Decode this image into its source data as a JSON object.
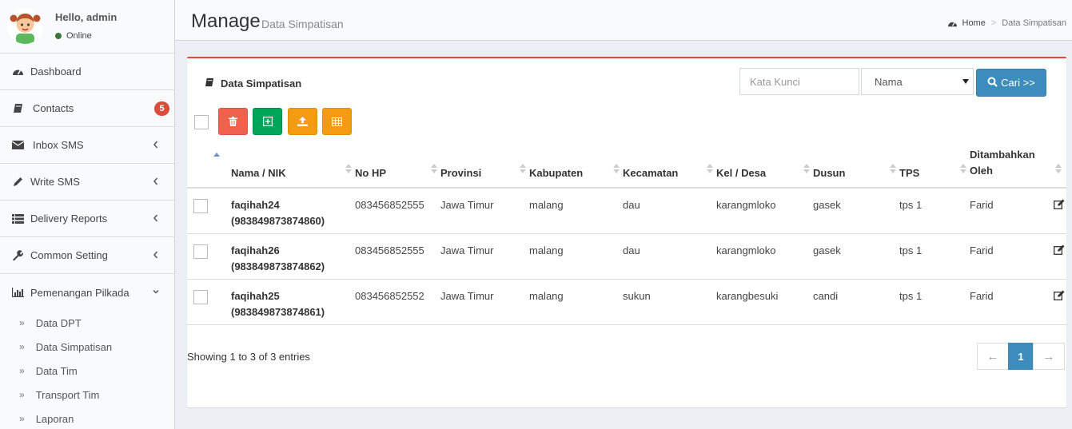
{
  "sidebar": {
    "user_name": "Hello, admin",
    "user_status": "Online",
    "items": [
      {
        "label": "Dashboard"
      },
      {
        "label": "Contacts",
        "badge": "5"
      },
      {
        "label": "Inbox SMS"
      },
      {
        "label": "Write SMS"
      },
      {
        "label": "Delivery Reports"
      },
      {
        "label": "Common Setting"
      },
      {
        "label": "Pemenangan Pilkada"
      }
    ],
    "sub_items": [
      {
        "label": "Data DPT"
      },
      {
        "label": "Data Simpatisan"
      },
      {
        "label": "Data Tim"
      },
      {
        "label": "Transport Tim"
      },
      {
        "label": "Laporan"
      }
    ]
  },
  "header": {
    "title": "Manage",
    "subtitle": "Data Simpatisan",
    "breadcrumb": {
      "home": "Home",
      "separator": ">",
      "current": "Data Simpatisan"
    }
  },
  "box": {
    "title": "Data Simpatisan",
    "search_placeholder": "Kata Kunci",
    "search_field_selected": "Nama",
    "search_button": "Cari >>"
  },
  "table": {
    "columns": [
      "Nama / NIK",
      "No HP",
      "Provinsi",
      "Kabupaten",
      "Kecamatan",
      "Kel / Desa",
      "Dusun",
      "TPS",
      "Ditambahkan Oleh"
    ],
    "rows": [
      {
        "name": "faqihah24",
        "nik": "(983849873874860)",
        "hp": "083456852555",
        "provinsi": "Jawa Timur",
        "kabupaten": "malang",
        "kecamatan": "dau",
        "desa": "karangmloko",
        "dusun": "gasek",
        "tps": "tps 1",
        "oleh": "Farid"
      },
      {
        "name": "faqihah26",
        "nik": "(983849873874862)",
        "hp": "083456852555",
        "provinsi": "Jawa Timur",
        "kabupaten": "malang",
        "kecamatan": "dau",
        "desa": "karangmloko",
        "dusun": "gasek",
        "tps": "tps 1",
        "oleh": "Farid"
      },
      {
        "name": "faqihah25",
        "nik": "(983849873874861)",
        "hp": "083456852552",
        "provinsi": "Jawa Timur",
        "kabupaten": "malang",
        "kecamatan": "sukun",
        "desa": "karangbesuki",
        "dusun": "candi",
        "tps": "tps 1",
        "oleh": "Farid"
      }
    ]
  },
  "footer": {
    "showing": "Showing 1 to 3 of 3 entries",
    "prev": "←",
    "page": "1",
    "next": "→"
  },
  "colors": {
    "accent": "#3c8dbc",
    "danger": "#dd4b39",
    "success": "#00a65a",
    "warning": "#f39c12"
  },
  "icons": {
    "sidebar": [
      "dashboard-icon",
      "book-icon",
      "envelope-icon",
      "pencil-icon",
      "list-icon",
      "wrench-icon",
      "bar-chart-icon"
    ],
    "toolbar": [
      "trash-icon",
      "plus-square-icon",
      "upload-icon",
      "table-icon"
    ],
    "row_action": "edit-icon"
  }
}
